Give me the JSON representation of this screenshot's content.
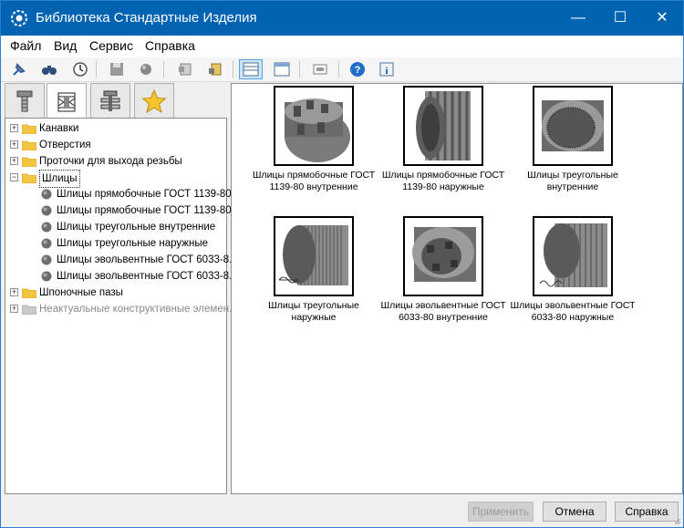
{
  "window": {
    "title": "Библиотека Стандартные Изделия",
    "minimize": "—",
    "maximize": "☐",
    "close": "✕"
  },
  "menu": [
    "Файл",
    "Вид",
    "Сервис",
    "Справка"
  ],
  "toolbar": {
    "icons": [
      "pin-icon",
      "binoculars-icon",
      "clock-icon",
      "save-icon",
      "sphere-icon",
      "list-icon",
      "export-icon",
      "thumbnails-view-icon",
      "details-view-icon",
      "preview-icon",
      "help-icon",
      "info-icon"
    ]
  },
  "tabs": [
    "bolt-tab-icon",
    "nut-tab-icon",
    "assembly-tab-icon",
    "favorites-star-icon"
  ],
  "tree": {
    "nodes": [
      {
        "label": "Канавки",
        "level": 0,
        "state": "collapsed",
        "icon": "folder"
      },
      {
        "label": "Отверстия",
        "level": 0,
        "state": "collapsed",
        "icon": "folder"
      },
      {
        "label": "Проточки для выхода резьбы",
        "level": 0,
        "state": "collapsed",
        "icon": "folder"
      },
      {
        "label": "Шлицы",
        "level": 0,
        "state": "expanded",
        "icon": "folder",
        "selected": true
      },
      {
        "label": "Шлицы прямобочные ГОСТ 1139-80...",
        "level": 1,
        "icon": "part"
      },
      {
        "label": "Шлицы прямобочные ГОСТ 1139-80...",
        "level": 1,
        "icon": "part"
      },
      {
        "label": "Шлицы треугольные внутренние",
        "level": 1,
        "icon": "part"
      },
      {
        "label": "Шлицы треугольные наружные",
        "level": 1,
        "icon": "part"
      },
      {
        "label": "Шлицы эвольвентные ГОСТ 6033-8...",
        "level": 1,
        "icon": "part"
      },
      {
        "label": "Шлицы эвольвентные ГОСТ 6033-8...",
        "level": 1,
        "icon": "part"
      },
      {
        "label": "Шпоночные пазы",
        "level": 0,
        "state": "collapsed",
        "icon": "folder"
      },
      {
        "label": "Неактуальные конструктивные элемен...",
        "level": 0,
        "state": "collapsed",
        "icon": "folder-gray",
        "disabled": true
      }
    ]
  },
  "grid": {
    "items": [
      {
        "line1": "Шлицы прямобочные ГОСТ",
        "line2": "1139-80 внутренние",
        "kind": "internal-straight"
      },
      {
        "line1": "Шлицы прямобочные ГОСТ",
        "line2": "1139-80 наружные",
        "kind": "external-straight"
      },
      {
        "line1": "Шлицы треугольные",
        "line2": "внутренние",
        "kind": "internal-triangle"
      },
      {
        "line1": "Шлицы треугольные",
        "line2": "наружные",
        "kind": "external-triangle"
      },
      {
        "line1": "Шлицы эвольвентные ГОСТ",
        "line2": "6033-80 внутренние",
        "kind": "internal-involute"
      },
      {
        "line1": "Шлицы эвольвентные ГОСТ",
        "line2": "6033-80 наружные",
        "kind": "external-involute"
      }
    ]
  },
  "footer": {
    "apply": "Применить",
    "cancel": "Отмена",
    "help": "Справка"
  }
}
